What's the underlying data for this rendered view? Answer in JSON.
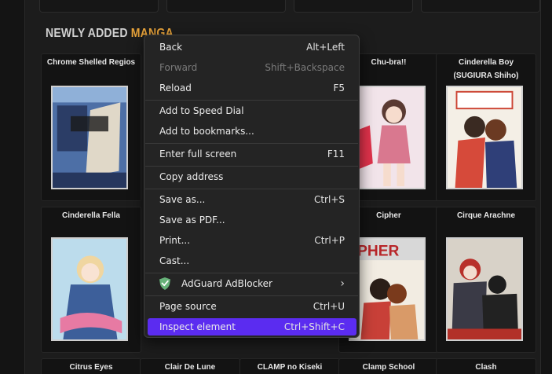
{
  "section": {
    "title_plain": "NEWLY ADDED ",
    "title_accent": "MANGA"
  },
  "cards": [
    {
      "title": "Chrome Shelled Regios",
      "cover_color": "#6a86b8"
    },
    {
      "title": "Chu-bra!!",
      "cover_color": "#e5c9d6"
    },
    {
      "title": "Cinderella Boy (SUGIURA Shiho)",
      "cover_color": "#d84a3a"
    },
    {
      "title": "Cinderella Fella",
      "cover_color": "#9fc6e0"
    },
    {
      "title": "Cipher",
      "cover_color": "#c9453a"
    },
    {
      "title": "Cirque Arachne",
      "cover_color": "#3a3a4a"
    },
    {
      "title": "Citrus Eyes"
    },
    {
      "title": "Clair De Lune"
    },
    {
      "title": "CLAMP no Kiseki"
    },
    {
      "title": "Clamp School"
    },
    {
      "title": "Clash"
    }
  ],
  "menu": {
    "items": [
      {
        "label": "Back",
        "shortcut": "Alt+Left",
        "enabled": true
      },
      {
        "label": "Forward",
        "shortcut": "Shift+Backspace",
        "enabled": false
      },
      {
        "label": "Reload",
        "shortcut": "F5",
        "enabled": true
      },
      {
        "label": "Add to Speed Dial",
        "shortcut": "",
        "enabled": true
      },
      {
        "label": "Add to bookmarks...",
        "shortcut": "",
        "enabled": true
      },
      {
        "label": "Enter full screen",
        "shortcut": "F11",
        "enabled": true
      },
      {
        "label": "Copy address",
        "shortcut": "",
        "enabled": true
      },
      {
        "label": "Save as...",
        "shortcut": "Ctrl+S",
        "enabled": true
      },
      {
        "label": "Save as PDF...",
        "shortcut": "",
        "enabled": true
      },
      {
        "label": "Print...",
        "shortcut": "Ctrl+P",
        "enabled": true
      },
      {
        "label": "Cast...",
        "shortcut": "",
        "enabled": true
      },
      {
        "label": "AdGuard AdBlocker",
        "shortcut": "",
        "enabled": true,
        "submenu": true,
        "icon": "adguard-shield-icon"
      },
      {
        "label": "Page source",
        "shortcut": "Ctrl+U",
        "enabled": true
      },
      {
        "label": "Inspect element",
        "shortcut": "Ctrl+Shift+C",
        "enabled": true,
        "highlighted": true
      }
    ],
    "submenu_glyph": "›"
  },
  "colors": {
    "accent": "#e8a33a",
    "menu_highlight": "#5b2cf0",
    "adguard_green": "#67b279"
  }
}
